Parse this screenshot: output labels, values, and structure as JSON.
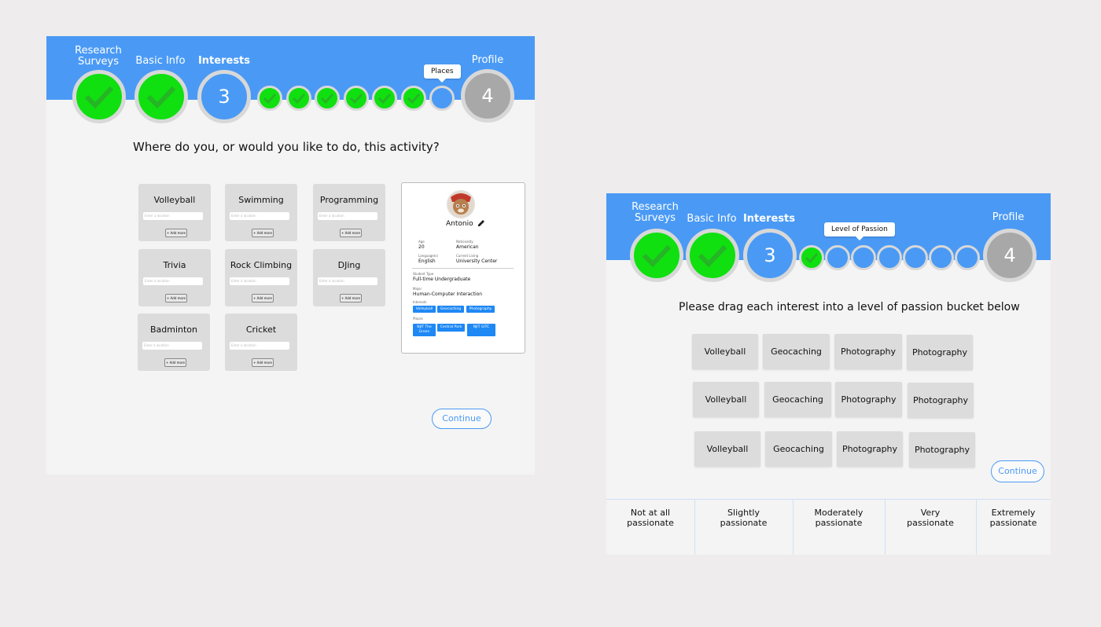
{
  "progress_left": {
    "steps": [
      {
        "label": "Research Surveys",
        "state": "done"
      },
      {
        "label": "Basic Info",
        "state": "done"
      },
      {
        "label": "Interests",
        "state": "active",
        "number": "3"
      },
      {
        "label": "Profile",
        "state": "upcoming",
        "number": "4"
      }
    ],
    "substeps_done": 6,
    "substeps_total": 7,
    "tooltip": "Places"
  },
  "places_screen": {
    "question": "Where do you, or would you like to do, this activity?",
    "activities": [
      {
        "name": "Volleyball",
        "placeholder": "Enter a location",
        "add_label": "+ Add more"
      },
      {
        "name": "Swimming",
        "placeholder": "Enter a location",
        "add_label": "+ Add more"
      },
      {
        "name": "Programming",
        "placeholder": "Enter a location",
        "add_label": "+ Add more"
      },
      {
        "name": "Trivia",
        "placeholder": "Enter a location",
        "add_label": "+ Add more"
      },
      {
        "name": "Rock Climbing",
        "placeholder": "Enter a location",
        "add_label": "+ Add more"
      },
      {
        "name": "DJing",
        "placeholder": "Enter a location",
        "add_label": "+ Add more"
      },
      {
        "name": "Badminton",
        "placeholder": "Enter a location",
        "add_label": "+ Add more"
      },
      {
        "name": "Cricket",
        "placeholder": "Enter a location",
        "add_label": "+ Add more"
      }
    ],
    "profile": {
      "name": "Antonio",
      "age_label": "Age",
      "age": "20",
      "nationality_label": "Nationality",
      "nationality": "American",
      "languages_label": "Language(s)",
      "languages": "English",
      "living_label": "Current Living",
      "living": "University Center",
      "student_type_label": "Student Type",
      "student_type": "Full-time Undergraduate",
      "major_label": "Major",
      "major": "Human-Computer Interaction",
      "interests_label": "Interests",
      "interests": [
        "Volleyball",
        "Geocaching",
        "Photography"
      ],
      "places_label": "Places",
      "places": [
        "NJIT The Green",
        "Central Park",
        "NJIT GITC"
      ]
    },
    "continue_label": "Continue"
  },
  "progress_right": {
    "steps": [
      {
        "label": "Research Surveys",
        "state": "done"
      },
      {
        "label": "Basic Info",
        "state": "done"
      },
      {
        "label": "Interests",
        "state": "active",
        "number": "3"
      },
      {
        "label": "Profile",
        "state": "upcoming",
        "number": "4"
      }
    ],
    "substeps_done": 1,
    "substeps_total": 7,
    "tooltip": "Level of Passion"
  },
  "passion_screen": {
    "instruction": "Please drag each interest into a level of passion bucket below",
    "rows": [
      [
        "Volleyball",
        "Geocaching",
        "Photography",
        "Photography"
      ],
      [
        "Volleyball",
        "Geocaching",
        "Photography",
        "Photography"
      ],
      [
        "Volleyball",
        "Geocaching",
        "Photography",
        "Photography"
      ]
    ],
    "continue_label": "Continue",
    "buckets": [
      "Not at all passionate",
      "Slightly passionate",
      "Moderately passionate",
      "Very passionate",
      "Extremely passionate"
    ]
  },
  "colors": {
    "header_blue": "#4a9af5",
    "done_green": "#10e010",
    "upcoming_grey": "#a8a8a8",
    "chip_blue": "#1e88f5"
  }
}
